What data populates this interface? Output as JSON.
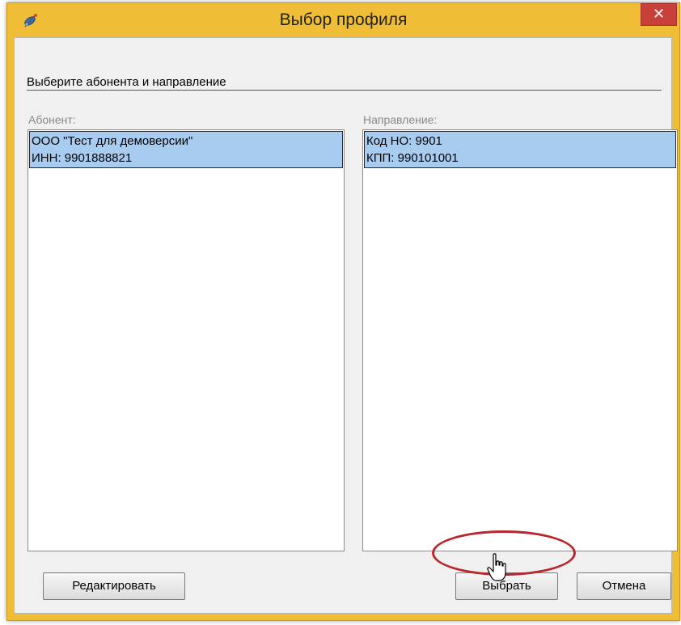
{
  "window": {
    "title": "Выбор профиля",
    "close_symbol": "✕",
    "app_icon": "satellite-icon",
    "frame_color": "#efbd36",
    "close_color": "#c7403a"
  },
  "group": {
    "title": "Выберите абонента и направление"
  },
  "subscriber": {
    "label": "Абонент:",
    "items": [
      {
        "line1": "ООО \"Тест для демоверсии\"",
        "line2": "ИНН: 9901888821",
        "selected": true
      }
    ]
  },
  "direction": {
    "label": "Направление:",
    "items": [
      {
        "line1": "Код НО: 9901",
        "line2": "КПП: 990101001",
        "selected": true
      }
    ]
  },
  "buttons": {
    "edit_label": "Редактировать",
    "select_label": "Выбрать",
    "cancel_label": "Отмена"
  },
  "annotation": {
    "highlight_color": "#b8272c",
    "cursor": "hand-pointer-icon"
  }
}
